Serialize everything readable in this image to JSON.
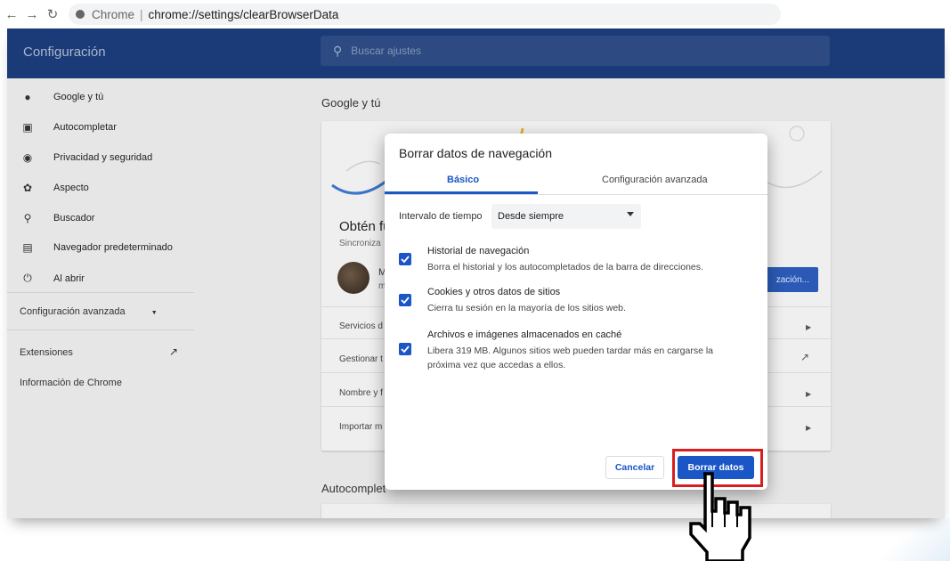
{
  "browser": {
    "site_label": "Chrome",
    "url": "chrome://settings/clearBrowserData"
  },
  "settings": {
    "title": "Configuración",
    "search_placeholder": "Buscar ajustes",
    "sidebar": [
      {
        "label": "Google y tú",
        "icon": "person-icon"
      },
      {
        "label": "Autocompletar",
        "icon": "clipboard-icon"
      },
      {
        "label": "Privacidad y seguridad",
        "icon": "shield-icon"
      },
      {
        "label": "Aspecto",
        "icon": "palette-icon"
      },
      {
        "label": "Buscador",
        "icon": "search-icon"
      },
      {
        "label": "Navegador predeterminado",
        "icon": "browser-icon"
      },
      {
        "label": "Al abrir",
        "icon": "power-icon"
      }
    ],
    "advanced_label": "Configuración avanzada",
    "extensions_label": "Extensiones",
    "about_label": "Información de Chrome",
    "main": {
      "section_title": "Google y tú",
      "card_heading_partial": "Obtén fu",
      "card_sub_partial": "Sincroniza",
      "account_letter": "M",
      "account_letter2": "m",
      "sync_button_partial": "zación...",
      "rows": [
        "Servicios d",
        "Gestionar t",
        "Nombre y f",
        "Importar m"
      ],
      "autocomplete_title_partial": "Autocomplet"
    }
  },
  "dialog": {
    "title": "Borrar datos de navegación",
    "tabs": [
      "Básico",
      "Configuración avanzada"
    ],
    "time_range_label": "Intervalo de tiempo",
    "time_range_value": "Desde siempre",
    "options": [
      {
        "title": "Historial de navegación",
        "desc": "Borra el historial y los autocompletados de la barra de direcciones.",
        "checked": true
      },
      {
        "title": "Cookies y otros datos de sitios",
        "desc": "Cierra tu sesión en la mayoría de los sitios web.",
        "checked": true
      },
      {
        "title": "Archivos e imágenes almacenados en caché",
        "desc": "Libera 319 MB. Algunos sitios web pueden tardar más en cargarse la próxima vez que accedas a ellos.",
        "checked": true
      }
    ],
    "cancel_label": "Cancelar",
    "clear_label": "Borrar datos"
  },
  "colors": {
    "accent": "#1a56c6",
    "topbar": "#1a3b78",
    "highlight": "#d81e1e"
  }
}
